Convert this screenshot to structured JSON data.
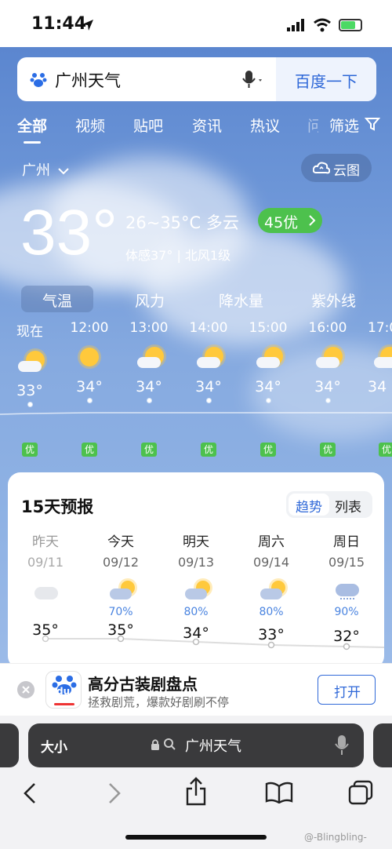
{
  "status": {
    "time": "11:44"
  },
  "search": {
    "query": "广州天气",
    "button": "百度一下"
  },
  "tabs": [
    "全部",
    "视频",
    "贴吧",
    "资讯",
    "热议",
    "问"
  ],
  "filter": "筛选",
  "city": "广州",
  "cloud_map": "云图",
  "current": {
    "temp": "33°",
    "range_cond": "26~35°C 多云",
    "aqi": "45优",
    "feels": "体感37° | 北风1级"
  },
  "subtabs": [
    "气温",
    "风力",
    "降水量",
    "紫外线"
  ],
  "hourly": [
    {
      "time": "现在",
      "temp": "33°",
      "aq": "优",
      "icon": "partly-cloudy-icon"
    },
    {
      "time": "12:00",
      "temp": "34°",
      "aq": "优",
      "icon": "sun-icon"
    },
    {
      "time": "13:00",
      "temp": "34°",
      "aq": "优",
      "icon": "partly-cloudy-icon"
    },
    {
      "time": "14:00",
      "temp": "34°",
      "aq": "优",
      "icon": "partly-cloudy-icon"
    },
    {
      "time": "15:00",
      "temp": "34°",
      "aq": "优",
      "icon": "partly-cloudy-icon"
    },
    {
      "time": "16:00",
      "temp": "34°",
      "aq": "优",
      "icon": "partly-cloudy-icon"
    },
    {
      "time": "17:0",
      "temp": "34",
      "aq": "优",
      "icon": "partly-cloudy-icon"
    }
  ],
  "forecast": {
    "title": "15天预报",
    "toggle": [
      "趋势",
      "列表"
    ],
    "days": [
      {
        "day": "昨天",
        "date": "09/11",
        "precip": "",
        "temp": "35°",
        "icon": "cloud-icon"
      },
      {
        "day": "今天",
        "date": "09/12",
        "precip": "70%",
        "temp": "35°",
        "icon": "rain-sun-icon"
      },
      {
        "day": "明天",
        "date": "09/13",
        "precip": "80%",
        "temp": "34°",
        "icon": "rain-sun-icon"
      },
      {
        "day": "周六",
        "date": "09/14",
        "precip": "80%",
        "temp": "33°",
        "icon": "rain-sun-icon"
      },
      {
        "day": "周日",
        "date": "09/15",
        "precip": "90%",
        "temp": "32°",
        "icon": "rain-cloud-icon"
      }
    ]
  },
  "promo": {
    "title": "高分古装剧盘点",
    "subtitle": "拯救剧荒，爆款好剧刷不停",
    "button": "打开",
    "logo": "du"
  },
  "address": {
    "aa": "大小",
    "url": "广州天气"
  },
  "watermark": "@-Blingbling-",
  "colors": {
    "accent": "#3069d8",
    "aqi_green": "#4dc14d",
    "sky": "#6e97d8"
  }
}
